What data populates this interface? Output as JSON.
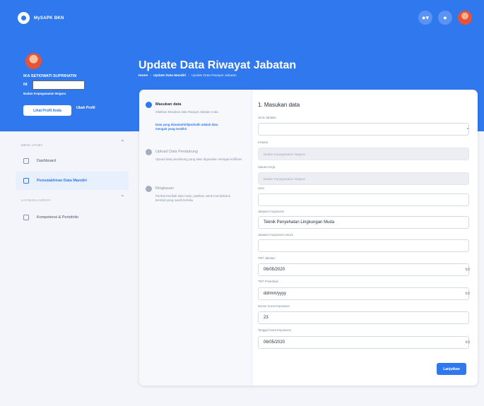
{
  "app": {
    "name": "MySAPK BKN"
  },
  "colors": {
    "primary": "#2f78ee",
    "background": "#f3f5fa",
    "card": "#ffffff"
  },
  "topbar": {
    "icons": [
      "toggle-icon",
      "notification-icon",
      "user-avatar"
    ]
  },
  "profile": {
    "name": "IKA SETIOWATI SUPRIHATIN",
    "nip": "NI",
    "agency": "Badan Kepegawaian Negara",
    "view_profile_label": "Lihat Profil Anda",
    "edit_profile_label": "Ubah Profil"
  },
  "sidebar": {
    "sections": [
      {
        "title": "MENU UTAMA",
        "items": [
          {
            "label": "Dashboard",
            "active": false
          },
          {
            "label": "Pemutakhiran Data Mandiri",
            "active": true
          }
        ]
      },
      {
        "title": "LAYANAN LAINNYA",
        "items": [
          {
            "label": "Kompetensi & Portofolio",
            "active": false
          }
        ]
      }
    ]
  },
  "page": {
    "title": "Update Data Riwayat Jabatan",
    "breadcrumbs": [
      "Home",
      "Update Data Mandiri",
      "Update Data Riwayat Jabatan"
    ]
  },
  "steps": [
    {
      "title": "Masukan data",
      "desc": "Silahkan Masukan data Riwayat Jabatan Anda",
      "note": "Data yang ditambahi/diperbaiki adalah data mengait yang terakhir",
      "active": true
    },
    {
      "title": "Upload Data Pendukung",
      "desc": "Upload data pendukung yang akan digunakan sebagai verifikasi",
      "active": false
    },
    {
      "title": "Ringkasan",
      "desc": "Periksa kembali data Anda, pastikan untuk membaharui kembali yang masih berlaku",
      "active": false
    }
  ],
  "form": {
    "title": "1. Masukan data",
    "fields": [
      {
        "label": "Jenis Jabatan",
        "value": "",
        "kind": "select"
      },
      {
        "label": "Instansi",
        "value": "Badan Kepegawaian Negara",
        "kind": "disabled"
      },
      {
        "label": "Satuan Kerja",
        "value": "Badan Kepegawaian Negara",
        "kind": "disabled"
      },
      {
        "label": "Unor",
        "value": "",
        "kind": "text"
      },
      {
        "label": "Jabatan Fungsional",
        "value": "Teknik Penyehatan Lingkungan Muda",
        "kind": "text"
      },
      {
        "label": "Jabatan Fungsional Umum",
        "value": "",
        "kind": "text"
      },
      {
        "label": "TMT Jabatan",
        "value": "06/05/2020",
        "kind": "date"
      },
      {
        "label": "TMT Pelantikan",
        "value": "dd/mm/yyyy",
        "kind": "date"
      },
      {
        "label": "Nomor Surat Keputusan",
        "value": "23",
        "kind": "text"
      },
      {
        "label": "Tanggal Surat Keputusan",
        "value": "06/05/2020",
        "kind": "date"
      }
    ],
    "submit_label": "Lanjutkan"
  }
}
